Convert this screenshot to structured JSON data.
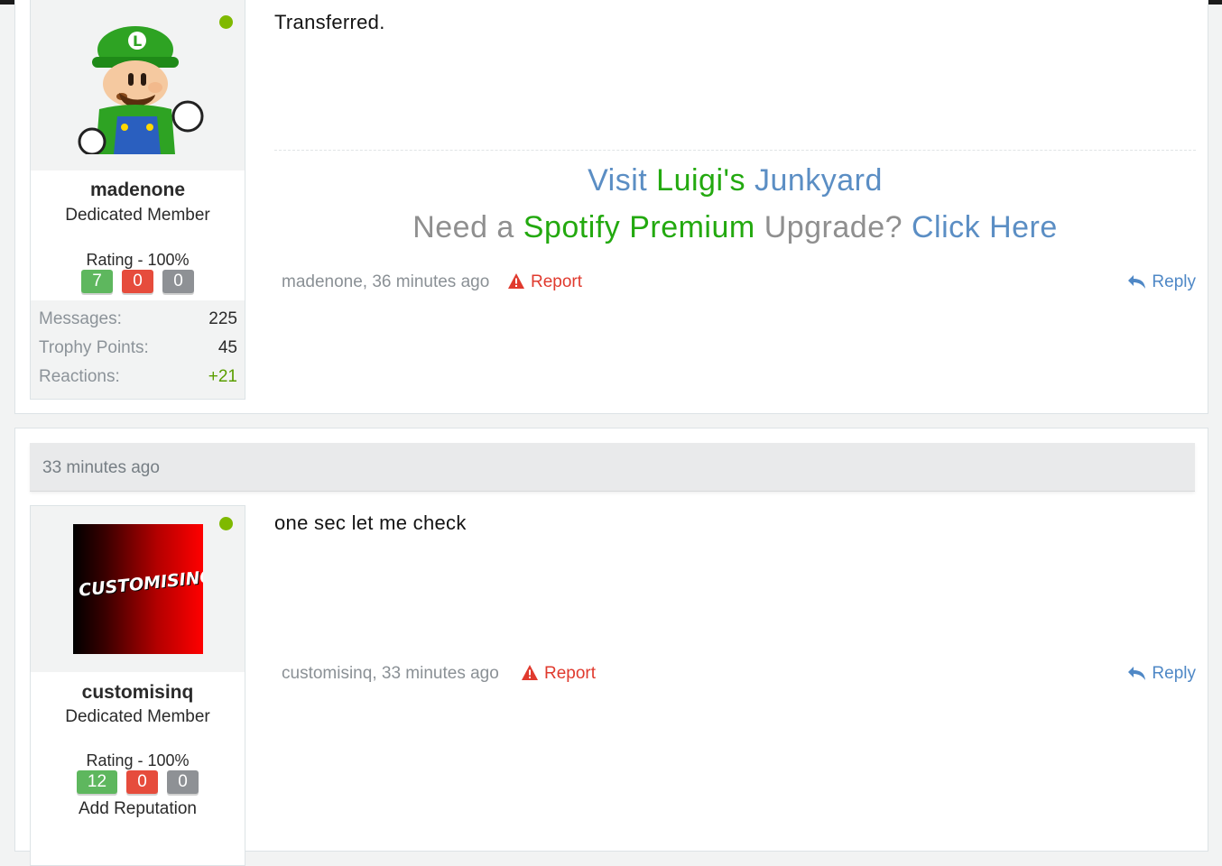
{
  "posts": [
    {
      "user": {
        "name": "madenone",
        "title": "Dedicated Member",
        "rating": "Rating - 100%",
        "rep_positive": "7",
        "rep_negative": "0",
        "rep_neutral": "0",
        "online": true,
        "avatar_icon": "luigi-avatar"
      },
      "stats": [
        {
          "label": "Messages:",
          "value": "225"
        },
        {
          "label": "Trophy Points:",
          "value": "45"
        },
        {
          "label": "Reactions:",
          "value": "+21"
        }
      ],
      "body": "Transferred.",
      "signature": {
        "line1": {
          "visit": "Visit",
          "luigis": "Luigi's",
          "junkyard": "Junkyard"
        },
        "line2": {
          "need": "Need a",
          "spotify": "Spotify",
          "premium": "Premium",
          "upgrade": "Upgrade?",
          "click_here": "Click Here"
        }
      },
      "footer": {
        "author_time": "madenone, 36 minutes ago",
        "report": "Report",
        "reply": "Reply"
      }
    },
    {
      "date_header": "33 minutes ago",
      "user": {
        "name": "customisinq",
        "title": "Dedicated Member",
        "rating": "Rating - 100%",
        "rep_positive": "12",
        "rep_negative": "0",
        "rep_neutral": "0",
        "add_reputation": "Add Reputation",
        "online": true,
        "avatar_text": "CUSTOMISINQ"
      },
      "body": "one sec let me check",
      "footer": {
        "author_time": "customisinq, 33 minutes ago",
        "report": "Report",
        "reply": "Reply"
      }
    }
  ],
  "colors": {
    "online": "#7fb900",
    "rep_positive": "#5eb75e",
    "rep_negative": "#e64c3c",
    "rep_neutral": "#8e9195",
    "link_blue": "#5b8ec4",
    "sig_green": "#23a90f",
    "report_red": "#e03a2e"
  }
}
